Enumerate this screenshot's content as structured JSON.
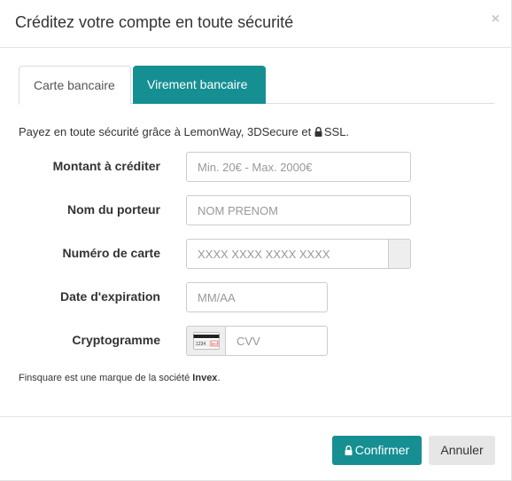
{
  "modal": {
    "title": "Créditez votre compte en toute sécurité",
    "close": "×"
  },
  "tabs": [
    {
      "label": "Carte bancaire",
      "active": true
    },
    {
      "label": "Virement bancaire",
      "active": false
    }
  ],
  "intro": {
    "before": "Payez en toute sécurité grâce à LemonWay, 3DSecure et",
    "after": "SSL."
  },
  "form": {
    "amount": {
      "label": "Montant à créditer",
      "placeholder": "Min. 20€ - Max. 2000€"
    },
    "holder": {
      "label": "Nom du porteur",
      "placeholder": "NOM PRENOM"
    },
    "card": {
      "label": "Numéro de carte",
      "placeholder": "XXXX XXXX XXXX XXXX"
    },
    "expiry": {
      "label": "Date d'expiration",
      "placeholder": "MM/AA"
    },
    "cvv": {
      "label": "Cryptogramme",
      "placeholder": "CVV",
      "card_digits": "1234",
      "card_code": "567"
    }
  },
  "note": {
    "before": "Finsquare est une marque de la société",
    "company": "Invex",
    "after": "."
  },
  "footer": {
    "confirm_label": "Confirmer",
    "cancel_label": "Annuler"
  },
  "colors": {
    "accent": "#168f93",
    "cancel_bg": "#e6e6e6"
  }
}
